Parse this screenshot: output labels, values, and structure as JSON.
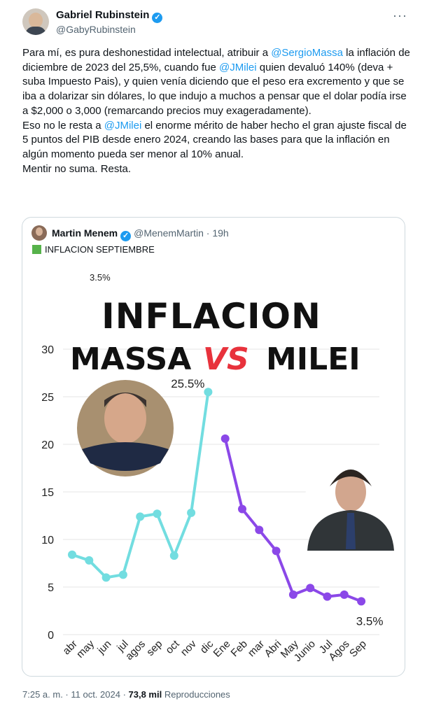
{
  "author": {
    "name": "Gabriel Rubinstein",
    "handle": "@GabyRubinstein",
    "verified_glyph": "✓"
  },
  "more_icon": "···",
  "tweet": {
    "p1_a": "Para mí, es pura deshonestidad intelectual, atribuir a ",
    "p1_mention1": "@SergioMassa",
    "p1_b": " la inflación de diciembre de 2023 del 25,5%, cuando fue ",
    "p1_mention2": "@JMilei",
    "p1_c": " quien devaluó 140% (deva + suba Impuesto Pais), y quien venía diciendo que el peso era excremento y que se iba a dolarizar sin dólares, lo que indujo a muchos a pensar que el dolar podía irse a $2,000 o 3,000 (remarcando precios muy exageradamente).",
    "p2_a": "Eso no le resta a ",
    "p2_mention": "@JMilei",
    "p2_b": " el enorme mérito de haber hecho el gran ajuste fiscal de 5 puntos del PIB desde enero 2024, creando las bases para que la inflación en algún momento pueda ser menor al 10% anual.",
    "p3": "Mentir no suma. Resta."
  },
  "quoted": {
    "name": "Martin Menem",
    "handle": "@MenemMartin · 19h",
    "text": "INFLACION SEPTIEMBRE",
    "chart_top_label": "3.5%"
  },
  "footer": {
    "time": "7:25 a. m. · 11 oct. 2024 · ",
    "views": "73,8 mil",
    "views_label": " Reproducciones"
  },
  "colors": {
    "massa_line": "#72dde0",
    "milei_line": "#8b48e8",
    "vs": "#e8323c",
    "grid": "#e6e6e6"
  },
  "chart_data": {
    "type": "line",
    "title_line1": "INFLACION",
    "title_left": "MASSA",
    "title_vs": "VS",
    "title_right": "MILEI",
    "categories": [
      "abr",
      "may",
      "jun",
      "jul",
      "agos",
      "sep",
      "oct",
      "nov",
      "dic",
      "Ene",
      "Feb",
      "mar",
      "Abri",
      "May",
      "Junio",
      "Jul",
      "Agos",
      "Sep"
    ],
    "yticks": [
      0,
      5,
      10,
      15,
      20,
      25,
      30
    ],
    "ylim": [
      0,
      30
    ],
    "grid": true,
    "series": [
      {
        "values": [
          8.4,
          7.8,
          6.0,
          6.3,
          12.4,
          12.7,
          8.3,
          12.8,
          25.5,
          null,
          null,
          null,
          null,
          null,
          null,
          null,
          null,
          null
        ]
      },
      {
        "values": [
          null,
          null,
          null,
          null,
          null,
          null,
          null,
          null,
          null,
          20.6,
          13.2,
          11.0,
          8.8,
          4.2,
          4.9,
          4.0,
          4.2,
          3.5
        ]
      }
    ],
    "annotations": [
      {
        "text": "25.5%",
        "category": "dic",
        "value": 25.5
      },
      {
        "text": "3.5%",
        "category": "Sep",
        "value": 3.5
      }
    ]
  }
}
